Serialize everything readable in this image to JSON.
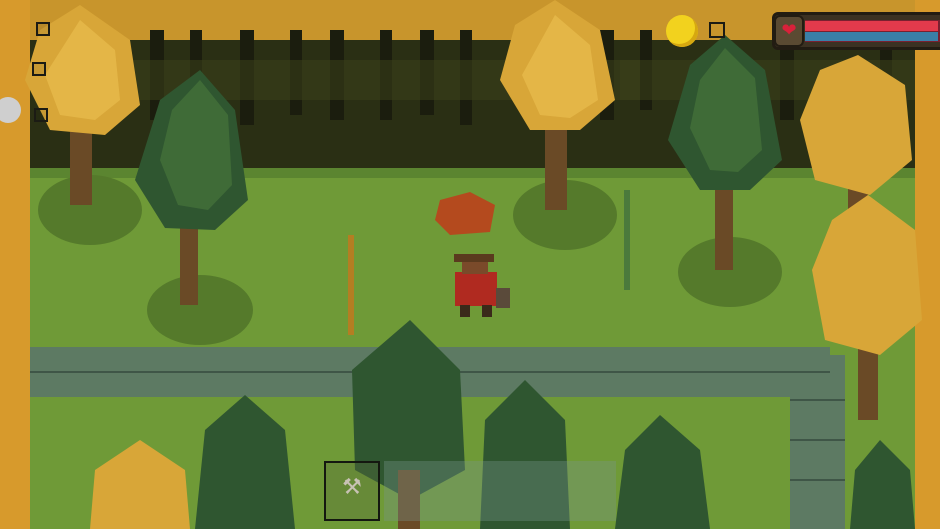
{
  "hud": {
    "coin": {
      "icon": "gold-coin-icon",
      "color": "#f2d21e"
    },
    "health": {
      "icon": "heart-icon",
      "heart_glyph": "❤",
      "fill_fraction": 0.95,
      "color": "#e33a4c",
      "secondary_color": "#3a7fa8"
    },
    "left_slots": [
      "empty",
      "empty",
      "empty",
      "empty"
    ]
  },
  "hotbar": {
    "slots": [
      {
        "item": "axe-icon",
        "glyph": "⚒",
        "selected": true
      },
      {
        "item": "empty",
        "glyph": "",
        "selected": false
      },
      {
        "item": "empty",
        "glyph": "",
        "selected": false
      },
      {
        "item": "empty",
        "glyph": "",
        "selected": false
      },
      {
        "item": "empty",
        "glyph": "",
        "selected": false
      }
    ]
  },
  "scene": {
    "palette": {
      "grass": "#6f9a37",
      "grass_light": "#7da63f",
      "forest_dark": "#2a2f14",
      "autumn": "#d8a638",
      "autumn_dark": "#b47e22",
      "pine": "#2f5630",
      "pine_light": "#4b7a3c",
      "stone": "#5d7a63",
      "stone_dark": "#3f5647",
      "trunk": "#6a4a26",
      "player_shirt": "#b02a20",
      "player_hat": "#5a3a1e"
    }
  }
}
